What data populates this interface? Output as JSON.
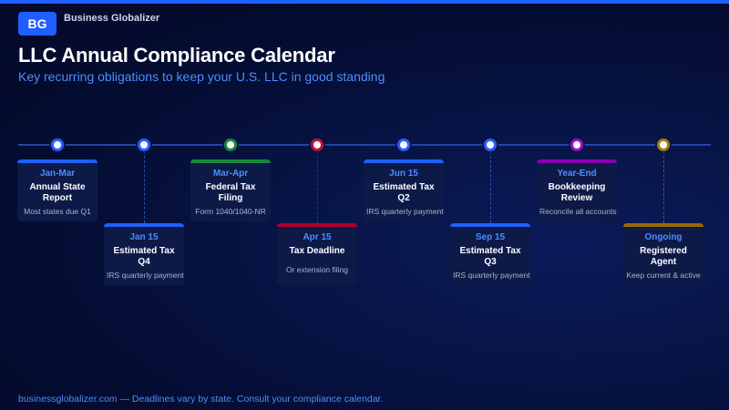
{
  "brand": {
    "badge": "BG",
    "name": "Business Globalizer"
  },
  "header": {
    "title": "LLC Annual Compliance Calendar",
    "subtitle": "Key recurring obligations to keep your U.S. LLC in good standing"
  },
  "colors": {
    "accent": "#1f5fff",
    "blue": "#1f5fff",
    "green": "#1a8a3a",
    "red": "#b0002a",
    "purple": "#8a00b0",
    "gold": "#9a6a00"
  },
  "milestones": [
    {
      "date": "Jan-Mar",
      "title": "Annual State Report",
      "note": "Most states due Q1",
      "color": "blue"
    },
    {
      "date": "Jan 15",
      "title": "Estimated Tax Q4",
      "note": "IRS quarterly payment",
      "color": "blue"
    },
    {
      "date": "Mar-Apr",
      "title": "Federal Tax Filing",
      "note": "Form 1040/1040-NR",
      "color": "green"
    },
    {
      "date": "Apr 15",
      "title": "Tax Deadline",
      "note": "Or extension filing",
      "color": "red"
    },
    {
      "date": "Jun 15",
      "title": "Estimated Tax Q2",
      "note": "IRS quarterly payment",
      "color": "blue"
    },
    {
      "date": "Sep 15",
      "title": "Estimated Tax Q3",
      "note": "IRS quarterly payment",
      "color": "blue"
    },
    {
      "date": "Year-End",
      "title": "Bookkeeping Review",
      "note": "Reconcile all accounts",
      "color": "purple"
    },
    {
      "date": "Ongoing",
      "title": "Registered Agent",
      "note": "Keep current & active",
      "color": "gold"
    }
  ],
  "footer": {
    "text": "businessglobalizer.com — Deadlines vary by state. Consult your compliance calendar."
  }
}
